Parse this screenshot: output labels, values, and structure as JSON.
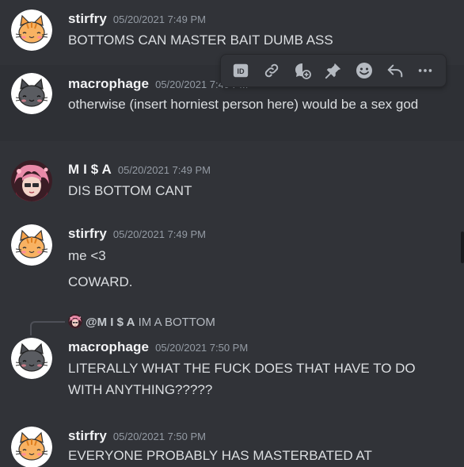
{
  "messages": [
    {
      "username": "stirfry",
      "timestamp": "05/20/2021 7:49 PM",
      "avatar": "orange-cat",
      "lines": [
        "BOTTOMS CAN MASTER BAIT DUMB ASS"
      ]
    },
    {
      "username": "macrophage",
      "timestamp": "05/20/2021 7:49 PM",
      "avatar": "grey-cat",
      "lines": [
        "otherwise (insert horniest person here) would be a sex god"
      ]
    },
    {
      "username": "M I $ A",
      "timestamp": "05/20/2021 7:49 PM",
      "avatar": "anime-pink",
      "lines": [
        "DIS BOTTOM CANT"
      ]
    },
    {
      "username": "stirfry",
      "timestamp": "05/20/2021 7:49 PM",
      "avatar": "orange-cat",
      "lines": [
        "me <3",
        "COWARD."
      ]
    },
    {
      "reply_to": {
        "name": "@M I $ A",
        "text": "IM A BOTTOM"
      },
      "username": "macrophage",
      "timestamp": "05/20/2021 7:50 PM",
      "avatar": "grey-cat",
      "lines": [
        "LITERALLY WHAT THE FUCK DOES THAT HAVE TO DO WITH ANYTHING?????"
      ]
    },
    {
      "username": "stirfry",
      "timestamp": "05/20/2021 7:50 PM",
      "avatar": "orange-cat",
      "lines": [
        "EVERYONE PROBABLY HAS MASTERBATED AT"
      ]
    }
  ],
  "toolbar": {
    "icons": [
      "copy-id-icon",
      "copy-link-icon",
      "create-thread-icon",
      "pin-icon",
      "add-reaction-icon",
      "reply-icon",
      "more-options-icon"
    ]
  },
  "colors": {
    "background": "#313338",
    "hover": "#2e3035",
    "username": "#f2f3f5",
    "timestamp": "#949ba4",
    "text": "#dbdee1"
  }
}
